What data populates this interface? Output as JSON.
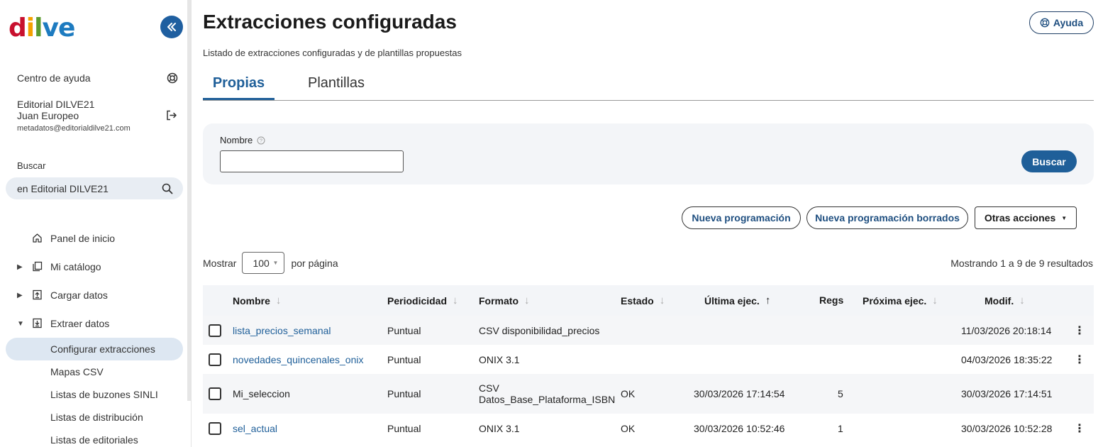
{
  "sidebar": {
    "logo": {
      "d": "d",
      "i": "i",
      "l": "l",
      "v": "v",
      "e": "e"
    },
    "help_center": "Centro de ayuda",
    "user": {
      "org": "Editorial DILVE21",
      "name": "Juan Europeo",
      "email": "metadatos@editorialdilve21.com"
    },
    "search": {
      "label": "Buscar",
      "value": "en Editorial DILVE21"
    },
    "nav": [
      {
        "label": "Panel de inicio"
      },
      {
        "label": "Mi catálogo"
      },
      {
        "label": "Cargar datos"
      },
      {
        "label": "Extraer datos"
      }
    ],
    "sub_items": [
      {
        "label": "Configurar extracciones"
      },
      {
        "label": "Mapas CSV"
      },
      {
        "label": "Listas de buzones SINLI"
      },
      {
        "label": "Listas de distribución"
      },
      {
        "label": "Listas de editoriales"
      }
    ]
  },
  "header": {
    "title": "Extracciones configuradas",
    "subtitle": "Listado de extracciones configuradas y de plantillas propuestas",
    "help_button": "Ayuda"
  },
  "tabs": [
    {
      "label": "Propias"
    },
    {
      "label": "Plantillas"
    }
  ],
  "filter": {
    "name_label": "Nombre",
    "name_value": "",
    "search_button": "Buscar"
  },
  "actions": {
    "new_schedule": "Nueva programación",
    "new_schedule_deleted": "Nueva programación borrados",
    "other_actions": "Otras acciones"
  },
  "pagination": {
    "show_label": "Mostrar",
    "per_page_value": "100",
    "per_page_label": "por página",
    "results_text": "Mostrando 1 a 9 de 9 resultados"
  },
  "table": {
    "columns": {
      "name": "Nombre",
      "periodicity": "Periodicidad",
      "format": "Formato",
      "status": "Estado",
      "last_run": "Última ejec.",
      "regs": "Regs",
      "next_run": "Próxima ejec.",
      "modified": "Modif."
    },
    "rows": [
      {
        "name": "lista_precios_semanal",
        "periodicity": "Puntual",
        "format": "CSV disponibilidad_precios",
        "status": "",
        "last_run": "",
        "regs": "",
        "next_run": "",
        "modified": "11/03/2026 20:18:14"
      },
      {
        "name": "novedades_quincenales_onix",
        "periodicity": "Puntual",
        "format": "ONIX 3.1",
        "status": "",
        "last_run": "",
        "regs": "",
        "next_run": "",
        "modified": "04/03/2026 18:35:22"
      },
      {
        "name": "Mi_seleccion",
        "periodicity": "Puntual",
        "format_line1": "CSV",
        "format_line2": "Datos_Base_Plataforma_ISBN",
        "status": "OK",
        "last_run": "30/03/2026 17:14:54",
        "regs": "5",
        "next_run": "",
        "modified": "30/03/2026 17:14:51"
      },
      {
        "name": "sel_actual",
        "periodicity": "Puntual",
        "format": "ONIX 3.1",
        "status": "OK",
        "last_run": "30/03/2026 10:52:46",
        "regs": "1",
        "next_run": "",
        "modified": "30/03/2026 10:52:28"
      }
    ]
  },
  "colors": {
    "primary": "#1f5f99",
    "active_nav_bg": "#dde7f2",
    "header_bg": "#f3f5f8"
  }
}
